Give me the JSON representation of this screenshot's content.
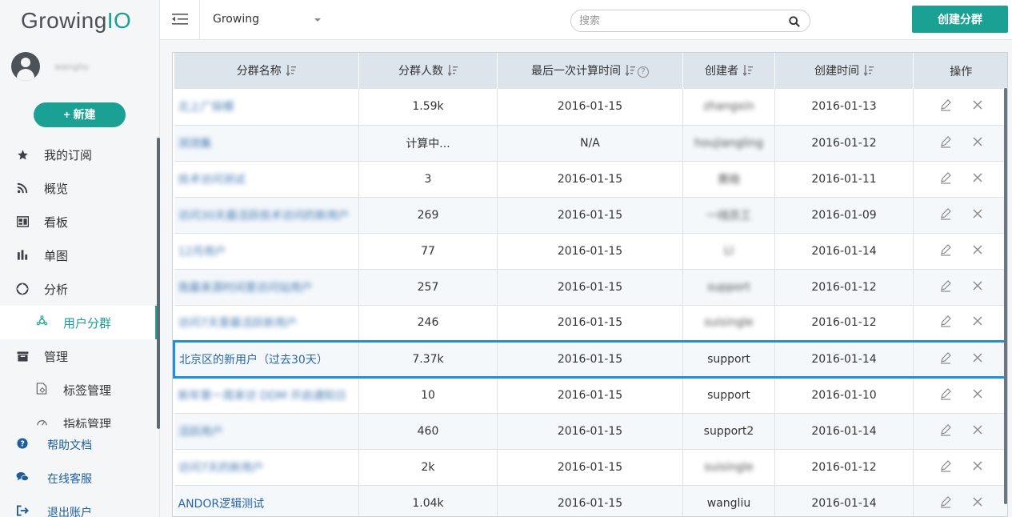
{
  "app": {
    "logo_main": "Growing",
    "logo_accent": "IO"
  },
  "user": {
    "name": "wangliu"
  },
  "sidebar": {
    "new_button": "+ 新建",
    "items": [
      {
        "label": "我的订阅",
        "icon": "star-icon"
      },
      {
        "label": "概览",
        "icon": "rss-icon"
      },
      {
        "label": "看板",
        "icon": "dashboard-icon"
      },
      {
        "label": "单图",
        "icon": "bar-chart-icon"
      },
      {
        "label": "分析",
        "icon": "aperture-icon"
      },
      {
        "label": "用户分群",
        "icon": "user-group-icon",
        "active": true
      },
      {
        "label": "管理",
        "icon": "folder-icon"
      },
      {
        "label": "标签管理",
        "icon": "tag-doc-icon"
      },
      {
        "label": "指标管理",
        "icon": "gauge-icon"
      }
    ],
    "bottom": [
      {
        "label": "帮助文档",
        "icon": "question-circle-icon"
      },
      {
        "label": "在线客服",
        "icon": "chat-icon"
      },
      {
        "label": "退出账户",
        "icon": "sign-out-icon"
      }
    ]
  },
  "topbar": {
    "project": "Growing",
    "search_placeholder": "搜索",
    "create_button": "创建分群"
  },
  "table": {
    "headers": [
      "分群名称",
      "分群人数",
      "最后一次计算时间",
      "创建者",
      "创建时间",
      "操作"
    ],
    "rows": [
      {
        "name": "北上广探模",
        "count": "1.59k",
        "calc": "2016-01-15",
        "creator": "zhangxin",
        "created": "2016-01-13",
        "blur_name": true,
        "blur_creator": true
      },
      {
        "name": "测测集",
        "count": "计算中...",
        "calc": "N/A",
        "creator": "houjiangling",
        "created": "2016-01-12",
        "blur_name": true,
        "blur_creator": true
      },
      {
        "name": "技术访问测试",
        "count": "3",
        "calc": "2016-01-15",
        "creator": "黄晓",
        "created": "2016-01-11",
        "blur_name": true,
        "blur_creator": true
      },
      {
        "name": "访问30天最活跃技术访问的新用户",
        "count": "269",
        "calc": "2016-01-15",
        "creator": "一线员工",
        "created": "2016-01-09",
        "blur_name": true,
        "blur_creator": true
      },
      {
        "name": "12月用户",
        "count": "77",
        "calc": "2016-01-15",
        "creator": "LI",
        "created": "2016-01-14",
        "blur_name": true,
        "blur_creator": true
      },
      {
        "name": "我最来源时间里访问站用户",
        "count": "257",
        "calc": "2016-01-15",
        "creator": "support",
        "created": "2016-01-12",
        "blur_name": true,
        "blur_creator": true
      },
      {
        "name": "访问7天里最活跃新用户",
        "count": "246",
        "calc": "2016-01-15",
        "creator": "suisingle",
        "created": "2016-01-12",
        "blur_name": true,
        "blur_creator": true
      },
      {
        "name": "北京区的新用户（过去30天）",
        "count": "7.37k",
        "calc": "2016-01-15",
        "creator": "support",
        "created": "2016-01-14",
        "selected": true
      },
      {
        "name": "新年第一周来访 DDM 开启通知日",
        "count": "10",
        "calc": "2016-01-15",
        "creator": "support",
        "created": "2016-01-10",
        "blur_name": true
      },
      {
        "name": "活跃用户",
        "count": "460",
        "calc": "2016-01-15",
        "creator": "support2",
        "created": "2016-01-14",
        "blur_name": true
      },
      {
        "name": "访问7天的新用户",
        "count": "2k",
        "calc": "2016-01-15",
        "creator": "suisingle",
        "created": "2016-01-12",
        "blur_name": true,
        "blur_creator": true
      },
      {
        "name": "ANDOR逻辑测试",
        "count": "1.04k",
        "calc": "2016-01-15",
        "creator": "wangliu",
        "created": "2016-01-14"
      }
    ]
  },
  "colors": {
    "accent": "#1aa194",
    "link": "#2a66a6",
    "selected_border": "#1f8fe0",
    "header_bg": "#dde5ec"
  }
}
